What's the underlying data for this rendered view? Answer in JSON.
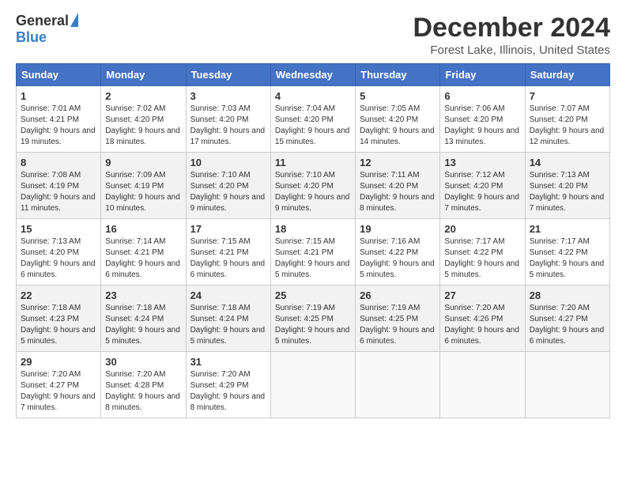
{
  "app": {
    "logo_general": "General",
    "logo_blue": "Blue"
  },
  "header": {
    "month_title": "December 2024",
    "location": "Forest Lake, Illinois, United States"
  },
  "days_of_week": [
    "Sunday",
    "Monday",
    "Tuesday",
    "Wednesday",
    "Thursday",
    "Friday",
    "Saturday"
  ],
  "weeks": [
    [
      {
        "day": "1",
        "sunrise": "7:01 AM",
        "sunset": "4:21 PM",
        "daylight": "9 hours and 19 minutes."
      },
      {
        "day": "2",
        "sunrise": "7:02 AM",
        "sunset": "4:20 PM",
        "daylight": "9 hours and 18 minutes."
      },
      {
        "day": "3",
        "sunrise": "7:03 AM",
        "sunset": "4:20 PM",
        "daylight": "9 hours and 17 minutes."
      },
      {
        "day": "4",
        "sunrise": "7:04 AM",
        "sunset": "4:20 PM",
        "daylight": "9 hours and 15 minutes."
      },
      {
        "day": "5",
        "sunrise": "7:05 AM",
        "sunset": "4:20 PM",
        "daylight": "9 hours and 14 minutes."
      },
      {
        "day": "6",
        "sunrise": "7:06 AM",
        "sunset": "4:20 PM",
        "daylight": "9 hours and 13 minutes."
      },
      {
        "day": "7",
        "sunrise": "7:07 AM",
        "sunset": "4:20 PM",
        "daylight": "9 hours and 12 minutes."
      }
    ],
    [
      {
        "day": "8",
        "sunrise": "7:08 AM",
        "sunset": "4:19 PM",
        "daylight": "9 hours and 11 minutes."
      },
      {
        "day": "9",
        "sunrise": "7:09 AM",
        "sunset": "4:19 PM",
        "daylight": "9 hours and 10 minutes."
      },
      {
        "day": "10",
        "sunrise": "7:10 AM",
        "sunset": "4:20 PM",
        "daylight": "9 hours and 9 minutes."
      },
      {
        "day": "11",
        "sunrise": "7:10 AM",
        "sunset": "4:20 PM",
        "daylight": "9 hours and 9 minutes."
      },
      {
        "day": "12",
        "sunrise": "7:11 AM",
        "sunset": "4:20 PM",
        "daylight": "9 hours and 8 minutes."
      },
      {
        "day": "13",
        "sunrise": "7:12 AM",
        "sunset": "4:20 PM",
        "daylight": "9 hours and 7 minutes."
      },
      {
        "day": "14",
        "sunrise": "7:13 AM",
        "sunset": "4:20 PM",
        "daylight": "9 hours and 7 minutes."
      }
    ],
    [
      {
        "day": "15",
        "sunrise": "7:13 AM",
        "sunset": "4:20 PM",
        "daylight": "9 hours and 6 minutes."
      },
      {
        "day": "16",
        "sunrise": "7:14 AM",
        "sunset": "4:21 PM",
        "daylight": "9 hours and 6 minutes."
      },
      {
        "day": "17",
        "sunrise": "7:15 AM",
        "sunset": "4:21 PM",
        "daylight": "9 hours and 6 minutes."
      },
      {
        "day": "18",
        "sunrise": "7:15 AM",
        "sunset": "4:21 PM",
        "daylight": "9 hours and 5 minutes."
      },
      {
        "day": "19",
        "sunrise": "7:16 AM",
        "sunset": "4:22 PM",
        "daylight": "9 hours and 5 minutes."
      },
      {
        "day": "20",
        "sunrise": "7:17 AM",
        "sunset": "4:22 PM",
        "daylight": "9 hours and 5 minutes."
      },
      {
        "day": "21",
        "sunrise": "7:17 AM",
        "sunset": "4:22 PM",
        "daylight": "9 hours and 5 minutes."
      }
    ],
    [
      {
        "day": "22",
        "sunrise": "7:18 AM",
        "sunset": "4:23 PM",
        "daylight": "9 hours and 5 minutes."
      },
      {
        "day": "23",
        "sunrise": "7:18 AM",
        "sunset": "4:24 PM",
        "daylight": "9 hours and 5 minutes."
      },
      {
        "day": "24",
        "sunrise": "7:18 AM",
        "sunset": "4:24 PM",
        "daylight": "9 hours and 5 minutes."
      },
      {
        "day": "25",
        "sunrise": "7:19 AM",
        "sunset": "4:25 PM",
        "daylight": "9 hours and 5 minutes."
      },
      {
        "day": "26",
        "sunrise": "7:19 AM",
        "sunset": "4:25 PM",
        "daylight": "9 hours and 6 minutes."
      },
      {
        "day": "27",
        "sunrise": "7:20 AM",
        "sunset": "4:26 PM",
        "daylight": "9 hours and 6 minutes."
      },
      {
        "day": "28",
        "sunrise": "7:20 AM",
        "sunset": "4:27 PM",
        "daylight": "9 hours and 6 minutes."
      }
    ],
    [
      {
        "day": "29",
        "sunrise": "7:20 AM",
        "sunset": "4:27 PM",
        "daylight": "9 hours and 7 minutes."
      },
      {
        "day": "30",
        "sunrise": "7:20 AM",
        "sunset": "4:28 PM",
        "daylight": "9 hours and 8 minutes."
      },
      {
        "day": "31",
        "sunrise": "7:20 AM",
        "sunset": "4:29 PM",
        "daylight": "9 hours and 8 minutes."
      },
      null,
      null,
      null,
      null
    ]
  ]
}
